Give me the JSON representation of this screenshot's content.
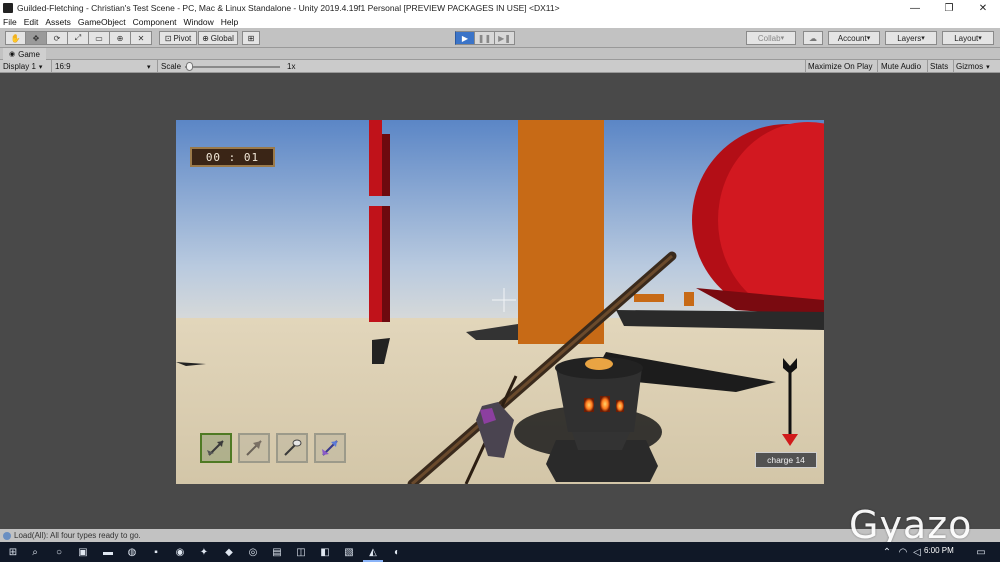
{
  "window": {
    "title": "Guilded-Fletching - Christian's Test Scene - PC, Mac & Linux Standalone - Unity 2019.4.19f1 Personal [PREVIEW PACKAGES IN USE] <DX11>",
    "minimize": "—",
    "maximize": "❐",
    "close": "✕"
  },
  "menu": [
    "File",
    "Edit",
    "Assets",
    "GameObject",
    "Component",
    "Window",
    "Help"
  ],
  "toolbar": {
    "pivot_label": "Pivot",
    "global_label": "Global",
    "collab_label": "Collab",
    "account_label": "Account",
    "layers_label": "Layers",
    "layout_label": "Layout",
    "play_state": "playing"
  },
  "game_view": {
    "tab_label": "Game",
    "display_label": "Display 1",
    "aspect_label": "16:9",
    "scale_label": "Scale",
    "scale_value": "1x",
    "maximize_on_play": "Maximize On Play",
    "mute_audio": "Mute Audio",
    "stats": "Stats",
    "gizmos": "Gizmos"
  },
  "hud": {
    "timer": "00 : 01",
    "charge_text": "charge 14",
    "inventory_slots": [
      {
        "icon": "arrow-icon",
        "selected": true
      },
      {
        "icon": "feather-arrow-icon",
        "selected": false
      },
      {
        "icon": "shovel-arrow-icon",
        "selected": false
      },
      {
        "icon": "ice-arrow-icon",
        "selected": false
      }
    ]
  },
  "status": {
    "message": "Load(All): All four types ready to go."
  },
  "taskbar": {
    "time": "6:00 PM"
  },
  "watermark": "Gyazo",
  "colors": {
    "unity_toolbar": "#c2c2c2",
    "play_active": "#3b74c8",
    "game_bg": "#494949",
    "sky_top": "#5b86c6",
    "ground": "#d9cdb1",
    "red_pillar": "#c0121a",
    "orange_pillar": "#c76a16",
    "charge_arrow": "#d11a1a"
  }
}
